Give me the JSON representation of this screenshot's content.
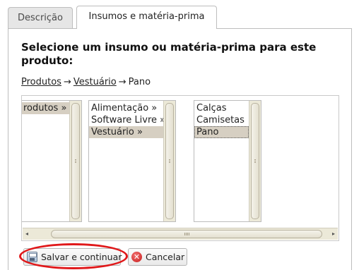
{
  "tabs": [
    {
      "label": "Descrição",
      "active": false
    },
    {
      "label": "Insumos e matéria-prima",
      "active": true
    }
  ],
  "heading": "Selecione um insumo ou matéria-prima para este produto:",
  "breadcrumb": {
    "links": [
      "Produtos",
      "Vestuário"
    ],
    "arrow": "→",
    "current": "Pano"
  },
  "columns": [
    {
      "items": [
        {
          "label": "rodutos »",
          "selected": true
        }
      ]
    },
    {
      "items": [
        {
          "label": "Alimentação »",
          "selected": false
        },
        {
          "label": "Software Livre »",
          "selected": false
        },
        {
          "label": "Vestuário »",
          "selected": true
        }
      ]
    },
    {
      "items": [
        {
          "label": "Calças",
          "selected": false
        },
        {
          "label": "Camisetas",
          "selected": false
        },
        {
          "label": "Pano",
          "selected": true
        }
      ]
    }
  ],
  "scrollbar": {
    "left_arrow": "◂",
    "right_arrow": "▸"
  },
  "buttons": {
    "save_label": "Salvar e continuar",
    "cancel_label": "Cancelar",
    "cancel_glyph": "✕"
  },
  "colors": {
    "highlight": "#e0181a",
    "selection": "#d6cfc2"
  }
}
